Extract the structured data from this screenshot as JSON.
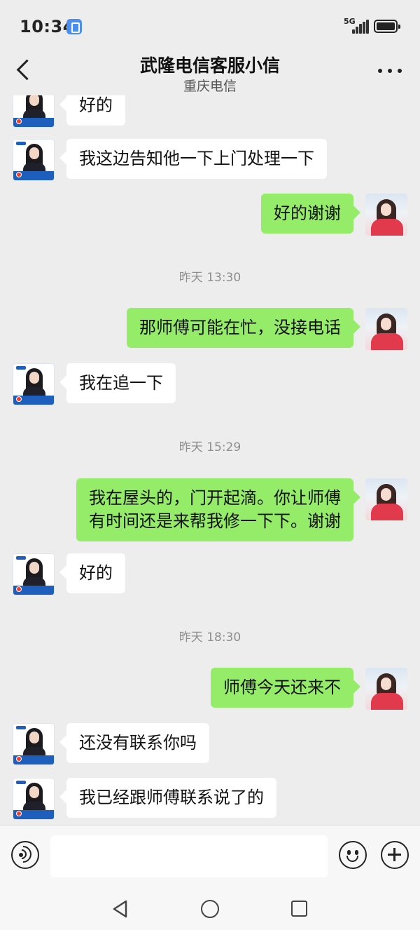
{
  "status_bar": {
    "time": "10:34",
    "network": "5G",
    "app_icon": "message-app-icon",
    "icons": [
      "signal-icon",
      "battery-icon"
    ]
  },
  "header": {
    "title": "武隆电信客服小信",
    "subtitle": "重庆电信",
    "back_icon": "chevron-left-icon",
    "more_icon": "more-horizontal-icon"
  },
  "messages": [
    {
      "sender": "agent",
      "lines": [
        "好的"
      ]
    },
    {
      "sender": "agent",
      "lines": [
        "我这边告知他一下上门处理一下"
      ]
    },
    {
      "sender": "user",
      "lines": [
        "好的谢谢"
      ]
    },
    {
      "timestamp": "昨天 13:30"
    },
    {
      "sender": "user",
      "lines": [
        "那师傅可能在忙，没接电话"
      ]
    },
    {
      "sender": "agent",
      "lines": [
        "我在追一下"
      ]
    },
    {
      "timestamp": "昨天 15:29"
    },
    {
      "sender": "user",
      "lines": [
        "我在屋头的，门开起滴。你让师傅",
        "有时间还是来帮我修一下下。谢谢"
      ]
    },
    {
      "sender": "agent",
      "lines": [
        "好的"
      ]
    },
    {
      "timestamp": "昨天 18:30"
    },
    {
      "sender": "user",
      "lines": [
        "师傅今天还来不"
      ]
    },
    {
      "sender": "agent",
      "lines": [
        "还没有联系你吗"
      ]
    },
    {
      "sender": "agent",
      "lines": [
        "我已经跟师傅联系说了的"
      ]
    }
  ],
  "input_bar": {
    "value": "",
    "voice_icon": "voice-icon",
    "emoji_icon": "emoji-icon",
    "plus_icon": "plus-circle-icon"
  },
  "system_nav": {
    "icons": [
      "nav-back-icon",
      "nav-home-icon",
      "nav-recent-icon"
    ]
  },
  "colors": {
    "background": "#ededed",
    "outgoing_bubble": "#95ec69",
    "incoming_bubble": "#ffffff"
  }
}
